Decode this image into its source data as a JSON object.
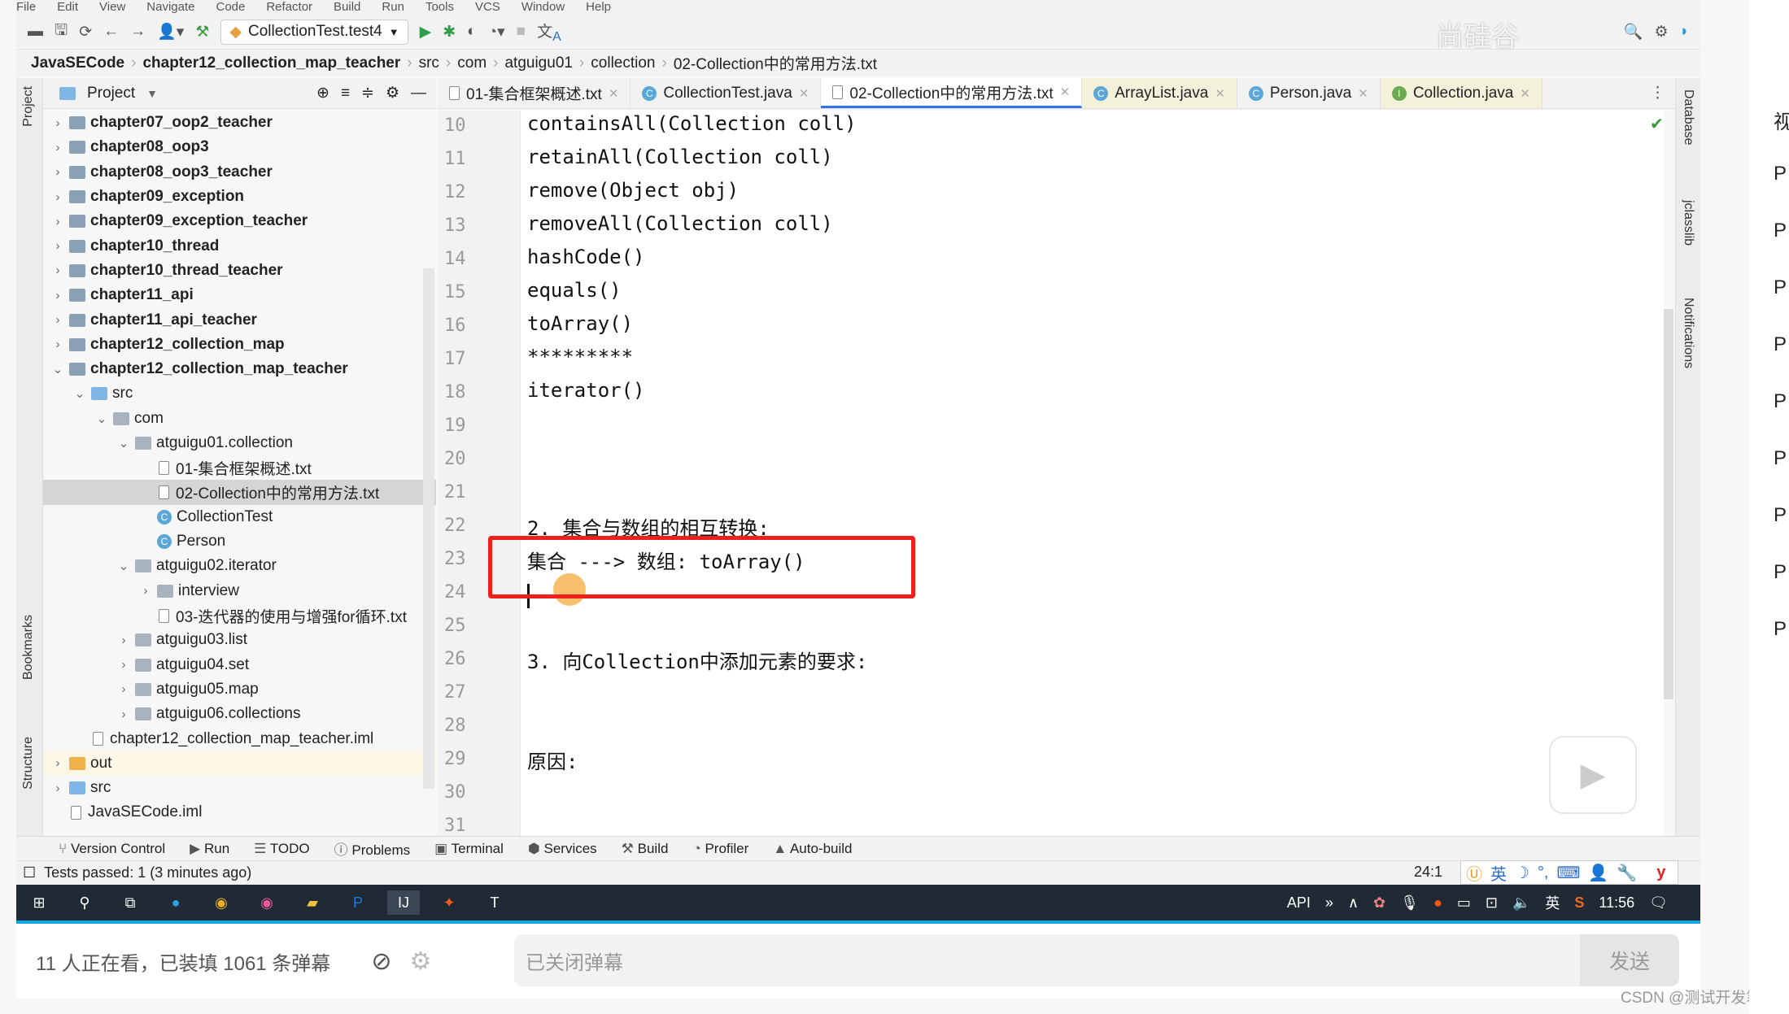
{
  "menubar": {
    "items": [
      "File",
      "Edit",
      "View",
      "Navigate",
      "Code",
      "Refactor",
      "Build",
      "Run",
      "Tools",
      "VCS",
      "Window",
      "Help"
    ]
  },
  "toolbar": {
    "run_config": "CollectionTest.test4"
  },
  "breadcrumb": [
    "JavaSECode",
    "chapter12_collection_map_teacher",
    "src",
    "com",
    "atguigu01",
    "collection",
    "02-Collection中的常用方法.txt"
  ],
  "watermark_logo": "尚硅谷",
  "left_strip": {
    "project": "Project",
    "bookmarks": "Bookmarks",
    "structure": "Structure"
  },
  "project_panel": {
    "title": "Project"
  },
  "tree": [
    {
      "label": "chapter07_oop2_teacher",
      "depth": 0,
      "type": "module",
      "state": "collapsed"
    },
    {
      "label": "chapter08_oop3",
      "depth": 0,
      "type": "module",
      "state": "collapsed"
    },
    {
      "label": "chapter08_oop3_teacher",
      "depth": 0,
      "type": "module",
      "state": "collapsed"
    },
    {
      "label": "chapter09_exception",
      "depth": 0,
      "type": "module",
      "state": "collapsed"
    },
    {
      "label": "chapter09_exception_teacher",
      "depth": 0,
      "type": "module",
      "state": "collapsed"
    },
    {
      "label": "chapter10_thread",
      "depth": 0,
      "type": "module",
      "state": "collapsed"
    },
    {
      "label": "chapter10_thread_teacher",
      "depth": 0,
      "type": "module",
      "state": "collapsed"
    },
    {
      "label": "chapter11_api",
      "depth": 0,
      "type": "module",
      "state": "collapsed"
    },
    {
      "label": "chapter11_api_teacher",
      "depth": 0,
      "type": "module",
      "state": "collapsed"
    },
    {
      "label": "chapter12_collection_map",
      "depth": 0,
      "type": "module",
      "state": "collapsed"
    },
    {
      "label": "chapter12_collection_map_teacher",
      "depth": 0,
      "type": "module",
      "state": "expanded"
    },
    {
      "label": "src",
      "depth": 1,
      "type": "srcfolder",
      "state": "expanded"
    },
    {
      "label": "com",
      "depth": 2,
      "type": "folder",
      "state": "expanded"
    },
    {
      "label": "atguigu01.collection",
      "depth": 3,
      "type": "folder",
      "state": "expanded"
    },
    {
      "label": "01-集合框架概述.txt",
      "depth": 4,
      "type": "file",
      "state": "none"
    },
    {
      "label": "02-Collection中的常用方法.txt",
      "depth": 4,
      "type": "file",
      "state": "none",
      "selected": true
    },
    {
      "label": "CollectionTest",
      "depth": 4,
      "type": "class",
      "state": "none"
    },
    {
      "label": "Person",
      "depth": 4,
      "type": "class",
      "state": "none"
    },
    {
      "label": "atguigu02.iterator",
      "depth": 3,
      "type": "folder",
      "state": "expanded"
    },
    {
      "label": "interview",
      "depth": 4,
      "type": "folder",
      "state": "collapsed"
    },
    {
      "label": "03-迭代器的使用与增强for循环.txt",
      "depth": 4,
      "type": "file",
      "state": "none"
    },
    {
      "label": "atguigu03.list",
      "depth": 3,
      "type": "folder",
      "state": "collapsed"
    },
    {
      "label": "atguigu04.set",
      "depth": 3,
      "type": "folder",
      "state": "collapsed"
    },
    {
      "label": "atguigu05.map",
      "depth": 3,
      "type": "folder",
      "state": "collapsed"
    },
    {
      "label": "atguigu06.collections",
      "depth": 3,
      "type": "folder",
      "state": "collapsed"
    },
    {
      "label": "chapter12_collection_map_teacher.iml",
      "depth": 1,
      "type": "file",
      "state": "none"
    },
    {
      "label": "out",
      "depth": 0,
      "type": "outfolder",
      "state": "collapsed",
      "highlighted": true
    },
    {
      "label": "src",
      "depth": 0,
      "type": "srcfolder",
      "state": "collapsed"
    },
    {
      "label": "JavaSECode.iml",
      "depth": 0,
      "type": "file",
      "state": "none"
    }
  ],
  "tabs": [
    {
      "label": "01-集合框架概述.txt",
      "icon": "text-file",
      "active": false
    },
    {
      "label": "CollectionTest.java",
      "icon": "class",
      "active": false
    },
    {
      "label": "02-Collection中的常用方法.txt",
      "icon": "text-file",
      "active": true
    },
    {
      "label": "ArrayList.java",
      "icon": "class",
      "active": false,
      "library": true
    },
    {
      "label": "Person.java",
      "icon": "class",
      "active": false
    },
    {
      "label": "Collection.java",
      "icon": "interface",
      "active": false,
      "library": true
    }
  ],
  "editor": {
    "lines": [
      {
        "n": "10",
        "text": "containsAll(Collection coll)"
      },
      {
        "n": "11",
        "text": "retainAll(Collection coll)"
      },
      {
        "n": "12",
        "text": "remove(Object obj)"
      },
      {
        "n": "13",
        "text": "removeAll(Collection coll)"
      },
      {
        "n": "14",
        "text": "hashCode()"
      },
      {
        "n": "15",
        "text": "equals()"
      },
      {
        "n": "16",
        "text": "toArray()"
      },
      {
        "n": "17",
        "text": "*********"
      },
      {
        "n": "18",
        "text": "iterator()"
      },
      {
        "n": "19",
        "text": ""
      },
      {
        "n": "20",
        "text": ""
      },
      {
        "n": "21",
        "text": ""
      },
      {
        "n": "22",
        "text": "2. 集合与数组的相互转换:"
      },
      {
        "n": "23",
        "text": "集合 ---> 数组: toArray()"
      },
      {
        "n": "24",
        "text": ""
      },
      {
        "n": "25",
        "text": ""
      },
      {
        "n": "26",
        "text": "3. 向Collection中添加元素的要求:"
      },
      {
        "n": "27",
        "text": ""
      },
      {
        "n": "28",
        "text": ""
      },
      {
        "n": "29",
        "text": "原因:"
      },
      {
        "n": "30",
        "text": ""
      },
      {
        "n": "31",
        "text": ""
      }
    ],
    "caret_line": 24,
    "highlight_color": "#f0201c"
  },
  "right_strip": {
    "database": "Database",
    "jclasslib": "jclasslib",
    "notifications": "Notifications"
  },
  "bottom_tools": [
    "Version Control",
    "Run",
    "TODO",
    "Problems",
    "Terminal",
    "Services",
    "Build",
    "Profiler",
    "Auto-build"
  ],
  "status": {
    "message": "Tests passed: 1 (3 minutes ago)",
    "position": "24:1",
    "ime": "英"
  },
  "taskbar": {
    "tray_api": "API",
    "tray_lang": "英",
    "clock": "11:56"
  },
  "danmaku": {
    "viewers": "11 人正在看，已装填 1061 条弹幕",
    "input_placeholder": "已关闭弹幕",
    "send": "发送"
  },
  "csdn_watermark": "CSDN @测试开发笔记",
  "side_panel": {
    "items": [
      "视",
      "P",
      "P",
      "P",
      "P",
      "P",
      "P",
      "P",
      "P",
      "P"
    ]
  }
}
